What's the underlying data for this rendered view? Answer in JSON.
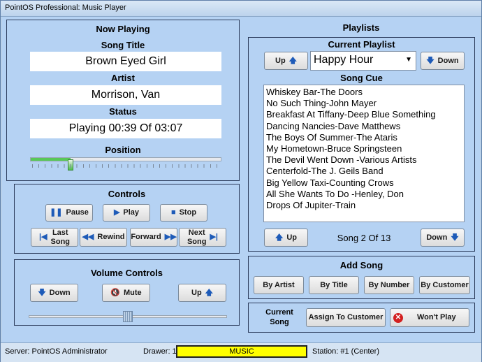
{
  "window": {
    "title": "PointOS Professional: Music Player"
  },
  "now_playing": {
    "header": "Now Playing",
    "song_title_label": "Song Title",
    "song_title": "Brown Eyed Girl",
    "artist_label": "Artist",
    "artist": "Morrison, Van",
    "status_label": "Status",
    "status": "Playing 00:39 Of 03:07",
    "position_label": "Position",
    "position_fraction": 0.21
  },
  "controls": {
    "header": "Controls",
    "pause": "Pause",
    "play": "Play",
    "stop": "Stop",
    "last_song": "Last\nSong",
    "rewind": "Rewind",
    "forward": "Forward",
    "next_song": "Next\nSong"
  },
  "volume": {
    "header": "Volume Controls",
    "down": "Down",
    "mute": "Mute",
    "up": "Up",
    "level_fraction": 0.5
  },
  "playlists": {
    "header": "Playlists",
    "current_playlist_label": "Current Playlist",
    "up": "Up",
    "down": "Down",
    "selected_playlist": "Happy Hour",
    "song_cue_label": "Song Cue",
    "songs": [
      "Whiskey Bar-The Doors",
      "No Such Thing-John Mayer",
      "Breakfast At Tiffany-Deep Blue Something",
      "Dancing Nancies-Dave Matthews",
      "The Boys Of Summer-The Ataris",
      "My Hometown-Bruce Springsteen",
      "The Devil Went Down -Various Artists",
      "Centerfold-The J. Geils Band",
      "Big Yellow Taxi-Counting Crows",
      "All She Wants To Do -Henley, Don",
      "Drops Of Jupiter-Train"
    ],
    "cue_up": "Up",
    "cue_down": "Down",
    "song_count": "Song 2 Of 13"
  },
  "add_song": {
    "header": "Add Song",
    "by_artist": "By Artist",
    "by_title": "By Title",
    "by_number": "By Number",
    "by_customer": "By Customer"
  },
  "current_song": {
    "label": "Current\nSong",
    "assign": "Assign To Customer",
    "wont_play": "Won't Play"
  },
  "statusbar": {
    "server": "Server: PointOS Administrator",
    "drawer": "Drawer: 1",
    "mode": "MUSIC",
    "station": "Station: #1 (Center)"
  },
  "colors": {
    "accent": "#1e5bb8",
    "mode_badge": "#ffff00",
    "panel_bg": "#b5d2f3"
  }
}
